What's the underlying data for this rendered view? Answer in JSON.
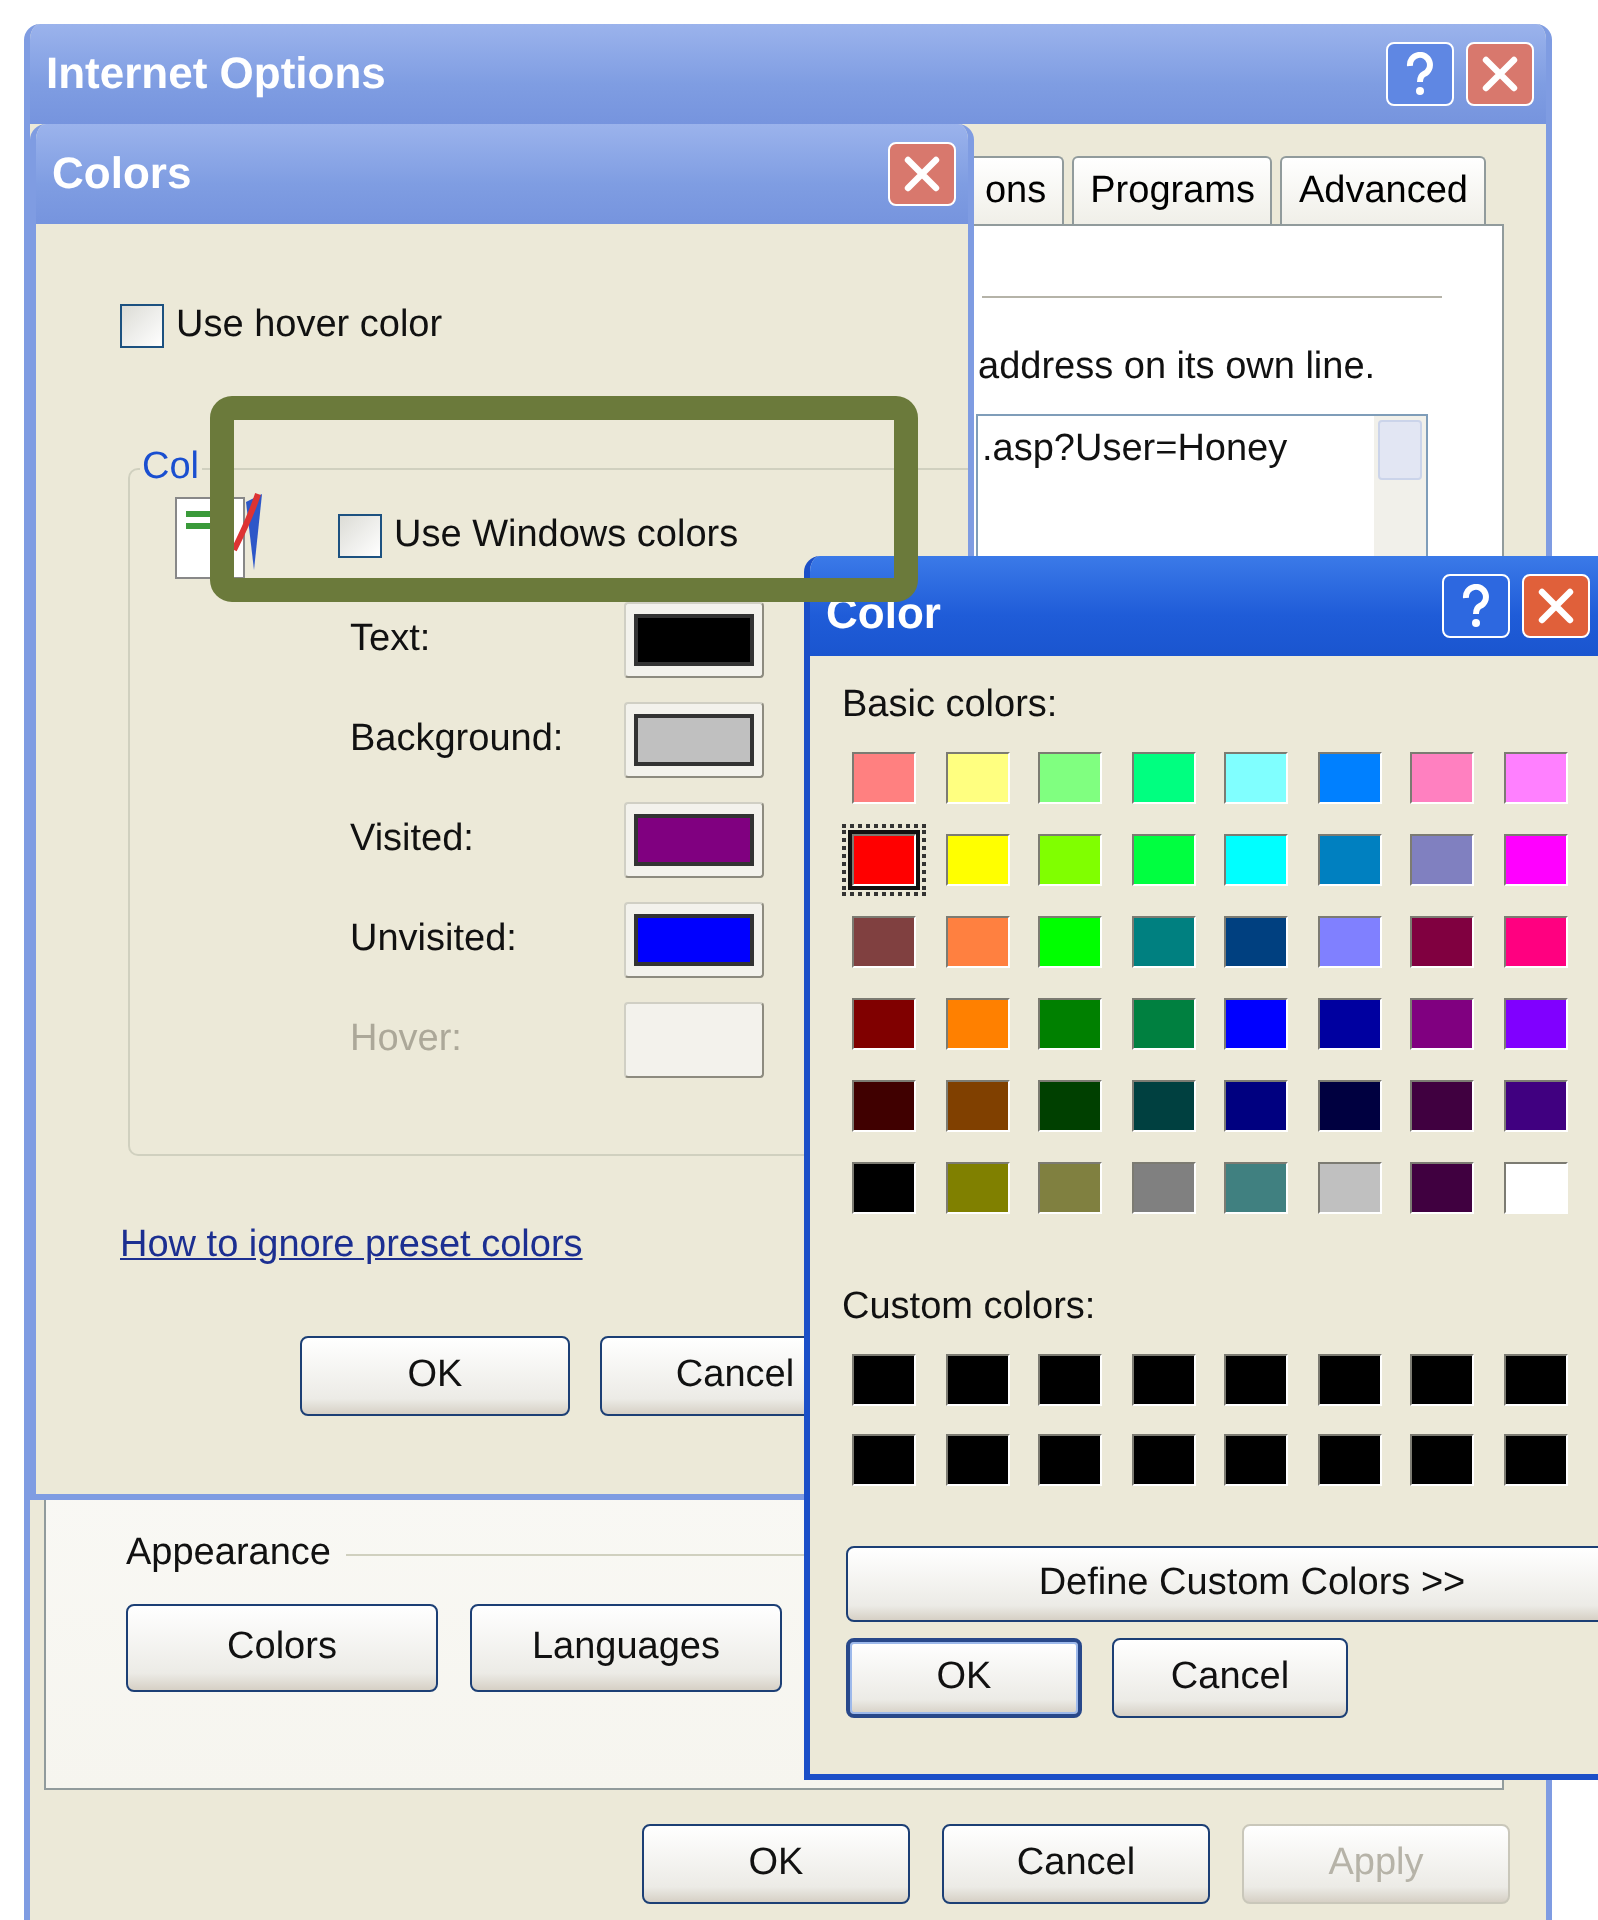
{
  "internet_options": {
    "title": "Internet Options",
    "tabs": [
      "ons",
      "Programs",
      "Advanced"
    ],
    "panel_text": "address on its own line.",
    "home_page_field": {
      "value": ".asp?User=Honey"
    },
    "appearance": {
      "title": "Appearance",
      "buttons": [
        "Colors",
        "Languages"
      ]
    },
    "buttons": [
      {
        "label": "OK",
        "disabled": false
      },
      {
        "label": "Cancel",
        "disabled": false
      },
      {
        "label": "Apply",
        "disabled": true
      }
    ]
  },
  "colors_dialog": {
    "title": "Colors",
    "hover_checkbox": {
      "label": "Use hover color",
      "checked": false
    },
    "group_title": "Col",
    "windows_colors_checkbox": {
      "label": "Use Windows colors",
      "checked": false
    },
    "color_rows": [
      {
        "label": "Text:",
        "color": "#000000",
        "disabled": false
      },
      {
        "label": "Background:",
        "color": "#c0c0c0",
        "disabled": false
      },
      {
        "label": "Visited:",
        "color": "#800080",
        "disabled": false
      },
      {
        "label": "Unvisited:",
        "color": "#0000ff",
        "disabled": false
      },
      {
        "label": "Hover:",
        "disabled": true
      }
    ],
    "link": "How to ignore preset colors",
    "buttons": [
      "OK",
      "Cancel"
    ]
  },
  "color_dialog": {
    "title": "Color",
    "basic_colors_label": "Basic colors:",
    "basic_colors": [
      {
        "color": "#ff8080",
        "selected": false
      },
      {
        "color": "#ffff80",
        "selected": false
      },
      {
        "color": "#80ff80",
        "selected": false
      },
      {
        "color": "#00ff80",
        "selected": false
      },
      {
        "color": "#80ffff",
        "selected": false
      },
      {
        "color": "#0080ff",
        "selected": false
      },
      {
        "color": "#ff80c0",
        "selected": false
      },
      {
        "color": "#ff80ff",
        "selected": false
      },
      {
        "color": "#ff0000",
        "selected": true
      },
      {
        "color": "#ffff00",
        "selected": false
      },
      {
        "color": "#80ff00",
        "selected": false
      },
      {
        "color": "#00ff40",
        "selected": false
      },
      {
        "color": "#00ffff",
        "selected": false
      },
      {
        "color": "#0080c0",
        "selected": false
      },
      {
        "color": "#8080c0",
        "selected": false
      },
      {
        "color": "#ff00ff",
        "selected": false
      },
      {
        "color": "#804040",
        "selected": false
      },
      {
        "color": "#ff8040",
        "selected": false
      },
      {
        "color": "#00ff00",
        "selected": false
      },
      {
        "color": "#008080",
        "selected": false
      },
      {
        "color": "#004080",
        "selected": false
      },
      {
        "color": "#8080ff",
        "selected": false
      },
      {
        "color": "#800040",
        "selected": false
      },
      {
        "color": "#ff0080",
        "selected": false
      },
      {
        "color": "#800000",
        "selected": false
      },
      {
        "color": "#ff8000",
        "selected": false
      },
      {
        "color": "#008000",
        "selected": false
      },
      {
        "color": "#008040",
        "selected": false
      },
      {
        "color": "#0000ff",
        "selected": false
      },
      {
        "color": "#0000a0",
        "selected": false
      },
      {
        "color": "#800080",
        "selected": false
      },
      {
        "color": "#8000ff",
        "selected": false
      },
      {
        "color": "#400000",
        "selected": false
      },
      {
        "color": "#804000",
        "selected": false
      },
      {
        "color": "#004000",
        "selected": false
      },
      {
        "color": "#004040",
        "selected": false
      },
      {
        "color": "#000080",
        "selected": false
      },
      {
        "color": "#000040",
        "selected": false
      },
      {
        "color": "#400040",
        "selected": false
      },
      {
        "color": "#400080",
        "selected": false
      },
      {
        "color": "#000000",
        "selected": false
      },
      {
        "color": "#808000",
        "selected": false
      },
      {
        "color": "#808040",
        "selected": false
      },
      {
        "color": "#808080",
        "selected": false
      },
      {
        "color": "#408080",
        "selected": false
      },
      {
        "color": "#c0c0c0",
        "selected": false
      },
      {
        "color": "#400040",
        "selected": false
      },
      {
        "color": "#ffffff",
        "selected": false
      }
    ],
    "custom_colors_label": "Custom colors:",
    "custom_colors": [
      {
        "color": "#000000"
      },
      {
        "color": "#000000"
      },
      {
        "color": "#000000"
      },
      {
        "color": "#000000"
      },
      {
        "color": "#000000"
      },
      {
        "color": "#000000"
      },
      {
        "color": "#000000"
      },
      {
        "color": "#000000"
      },
      {
        "color": "#000000"
      },
      {
        "color": "#000000"
      },
      {
        "color": "#000000"
      },
      {
        "color": "#000000"
      },
      {
        "color": "#000000"
      },
      {
        "color": "#000000"
      },
      {
        "color": "#000000"
      },
      {
        "color": "#000000"
      }
    ],
    "define_button": "Define Custom Colors >>",
    "buttons": [
      "OK",
      "Cancel"
    ]
  }
}
